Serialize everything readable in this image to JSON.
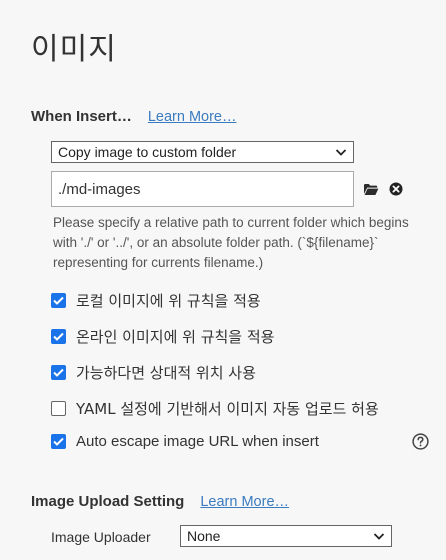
{
  "page": {
    "title": "이미지"
  },
  "when_insert": {
    "title": "When Insert…",
    "learn_more": "Learn More…",
    "action_select": {
      "value": "Copy image to custom folder"
    },
    "path_input": {
      "value": "./md-images"
    },
    "help_text": "Please specify a relative path to current folder which begins with './' or '../', or an absolute folder path. (`${filename}` representing for currents filename.)",
    "icons": {
      "folder": "folder-icon",
      "clear": "close-circle-icon"
    },
    "options": [
      {
        "label": "로컬 이미지에 위 규칙을 적용",
        "checked": true
      },
      {
        "label": "온라인 이미지에 위 규칙을 적용",
        "checked": true
      },
      {
        "label": "가능하다면 상대적 위치 사용",
        "checked": true
      },
      {
        "label": "YAML 설정에 기반해서 이미지 자동 업로드 허용",
        "checked": false
      },
      {
        "label": "Auto escape image URL when insert",
        "checked": true
      }
    ],
    "help_icon": "question-circle-icon"
  },
  "image_upload": {
    "title": "Image Upload Setting",
    "learn_more": "Learn More…",
    "uploader_label": "Image Uploader",
    "uploader_select": {
      "value": "None"
    }
  },
  "colors": {
    "accent": "#1a73e8",
    "link": "#3b7bc0",
    "background": "#f7f7f7"
  }
}
